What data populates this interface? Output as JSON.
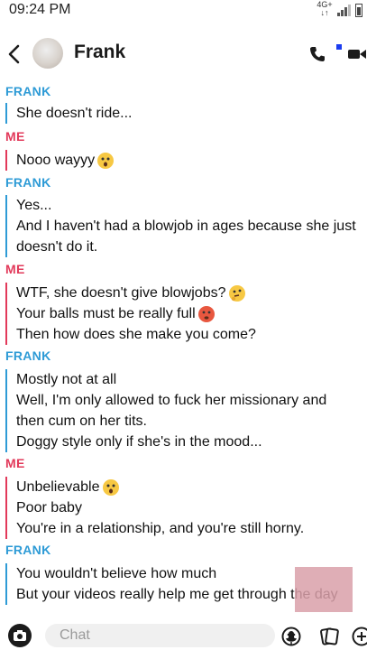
{
  "status_bar": {
    "time": "09:24 PM",
    "network": "4G+"
  },
  "header": {
    "contact_name": "Frank"
  },
  "messages": [
    {
      "sender": "FRANK",
      "lines": [
        "She doesn't ride..."
      ]
    },
    {
      "sender": "ME",
      "lines": [
        "Nooo wayyy"
      ]
    },
    {
      "sender": "FRANK",
      "lines": [
        "Yes...",
        "And I haven't had a blowjob in ages because she just",
        "doesn't do it."
      ]
    },
    {
      "sender": "ME",
      "lines": [
        "WTF, she doesn't give blowjobs?",
        "Your balls must be really full",
        "Then how does she make you come?"
      ]
    },
    {
      "sender": "FRANK",
      "lines": [
        "Mostly not at all",
        "Well, I'm only allowed to fuck her missionary and",
        "then cum on her tits.",
        "Doggy style only if she's in the mood..."
      ]
    },
    {
      "sender": "ME",
      "lines": [
        "Unbelievable",
        "Poor baby",
        "You're in a relationship, and you're still horny."
      ]
    },
    {
      "sender": "FRANK",
      "lines": [
        "You wouldn't believe how much",
        "But your videos really help me get through the day"
      ]
    }
  ],
  "composer": {
    "placeholder": "Chat"
  },
  "colors": {
    "frank": "#2e9bd6",
    "me": "#e2395a",
    "icon": "#1b1b1b"
  },
  "icons": [
    "back-icon",
    "call-icon",
    "video-icon",
    "camera-icon",
    "mic-icon",
    "smiley-icon",
    "cards-icon",
    "plus-icon",
    "astonished-emoji",
    "thinking-emoji",
    "hot-face-emoji"
  ]
}
